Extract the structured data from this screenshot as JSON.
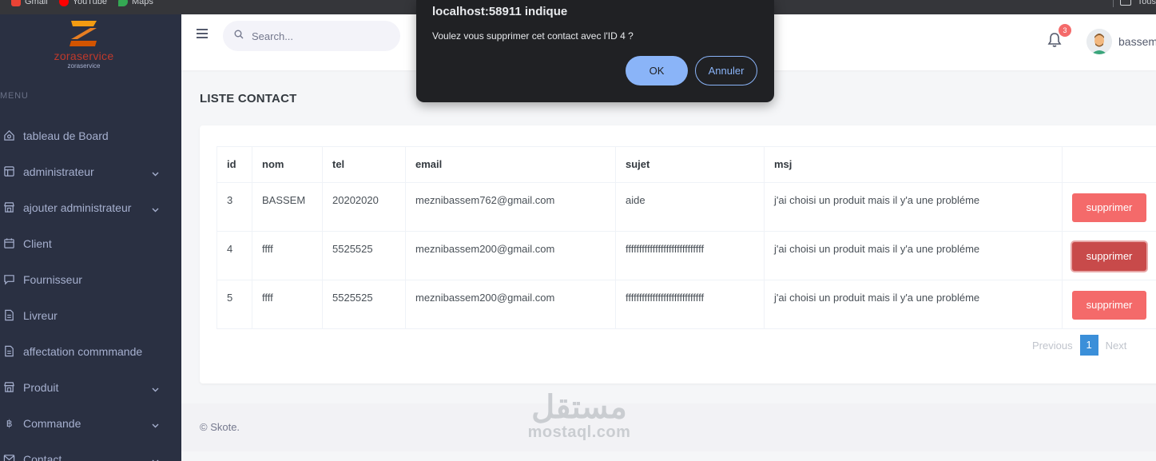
{
  "bookmarks": [
    {
      "label": "Gmail",
      "icon": "gmail-icon",
      "color": "#ea4335"
    },
    {
      "label": "YouTube",
      "icon": "youtube-icon",
      "color": "#ff0000"
    },
    {
      "label": "Maps",
      "icon": "maps-icon",
      "color": "#34a853"
    }
  ],
  "bookmarks_right": {
    "label": "Tous"
  },
  "logo": {
    "title": "zoraservice",
    "subtitle": "zoraservice"
  },
  "sidebar": {
    "menu_title": "MENU",
    "items": [
      {
        "label": "tableau de Board",
        "icon": "home-icon",
        "has_children": false
      },
      {
        "label": "administrateur",
        "icon": "layout-icon",
        "has_children": true
      },
      {
        "label": "ajouter administrateur",
        "icon": "store-icon",
        "has_children": true
      },
      {
        "label": "Client",
        "icon": "calendar-icon",
        "has_children": false
      },
      {
        "label": "Fournisseur",
        "icon": "chat-icon",
        "has_children": false
      },
      {
        "label": "Livreur",
        "icon": "file-icon",
        "has_children": false
      },
      {
        "label": "affectation commmande",
        "icon": "file-icon",
        "has_children": false
      },
      {
        "label": "Produit",
        "icon": "store-icon",
        "has_children": true
      },
      {
        "label": "Commande",
        "icon": "bitcoin-icon",
        "has_children": true
      },
      {
        "label": "Contact",
        "icon": "envelope-icon",
        "has_children": true
      }
    ]
  },
  "topbar": {
    "search_placeholder": "Search...",
    "notification_count": "3",
    "username": "bassem"
  },
  "page_title": "LISTE CONTACT",
  "table": {
    "headers": [
      "id",
      "nom",
      "tel",
      "email",
      "sujet",
      "msj"
    ],
    "rows": [
      {
        "id": "3",
        "nom": "BASSEM",
        "tel": "20202020",
        "email": "meznibassem762@gmail.com",
        "sujet": "aide",
        "msj": "j'ai choisi un produit mais il y'a une probléme",
        "action": "supprimer"
      },
      {
        "id": "4",
        "nom": "ffff",
        "tel": "5525525",
        "email": "meznibassem200@gmail.com",
        "sujet": "fffffffffffffffffffffffffffff",
        "msj": "j'ai choisi un produit mais il y'a une probléme",
        "action": "supprimer"
      },
      {
        "id": "5",
        "nom": "ffff",
        "tel": "5525525",
        "email": "meznibassem200@gmail.com",
        "sujet": "fffffffffffffffffffffffffffff",
        "msj": "j'ai choisi un produit mais il y'a une probléme",
        "action": "supprimer"
      }
    ]
  },
  "pagination": {
    "previous": "Previous",
    "current": "1",
    "next": "Next"
  },
  "footer": {
    "text": "© Skote."
  },
  "watermark": {
    "arabic": "مستقل",
    "latin": "mostaql.com"
  },
  "dialog": {
    "title": "localhost:58911 indique",
    "message": "Voulez vous supprimer cet contact avec l'ID 4 ?",
    "ok_label": "OK",
    "cancel_label": "Annuler"
  },
  "colors": {
    "sidebar": "#2a3042",
    "delete_button": "#f46a6a",
    "accent": "#3b8fd9",
    "badge": "#f46a6a"
  }
}
